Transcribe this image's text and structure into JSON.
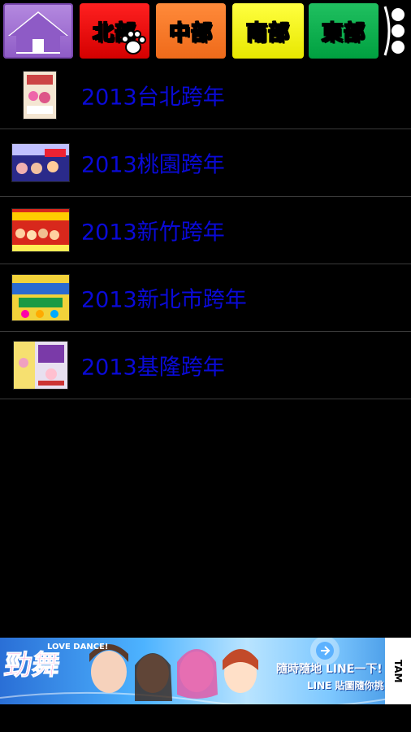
{
  "tabs": [
    {
      "label": "北部"
    },
    {
      "label": "中部"
    },
    {
      "label": "南部"
    },
    {
      "label": "東部"
    }
  ],
  "events": [
    {
      "title": "2013台北跨年"
    },
    {
      "title": "2013桃園跨年"
    },
    {
      "title": "2013新竹跨年"
    },
    {
      "title": "2013新北市跨年"
    },
    {
      "title": "2013基隆跨年"
    }
  ],
  "ad": {
    "title": "勁舞",
    "subtitle": "LOVE DANCE!",
    "line1": "隨時隨地 LINE一下!",
    "line2": "LINE 貼圖隨你挑!",
    "logo": "TAM"
  },
  "colors": {
    "link": "#0a0ad8",
    "north": "#e60000",
    "central": "#f07a2a",
    "south": "#f2f200",
    "east": "#00a850",
    "home": "#9b6bd6"
  }
}
